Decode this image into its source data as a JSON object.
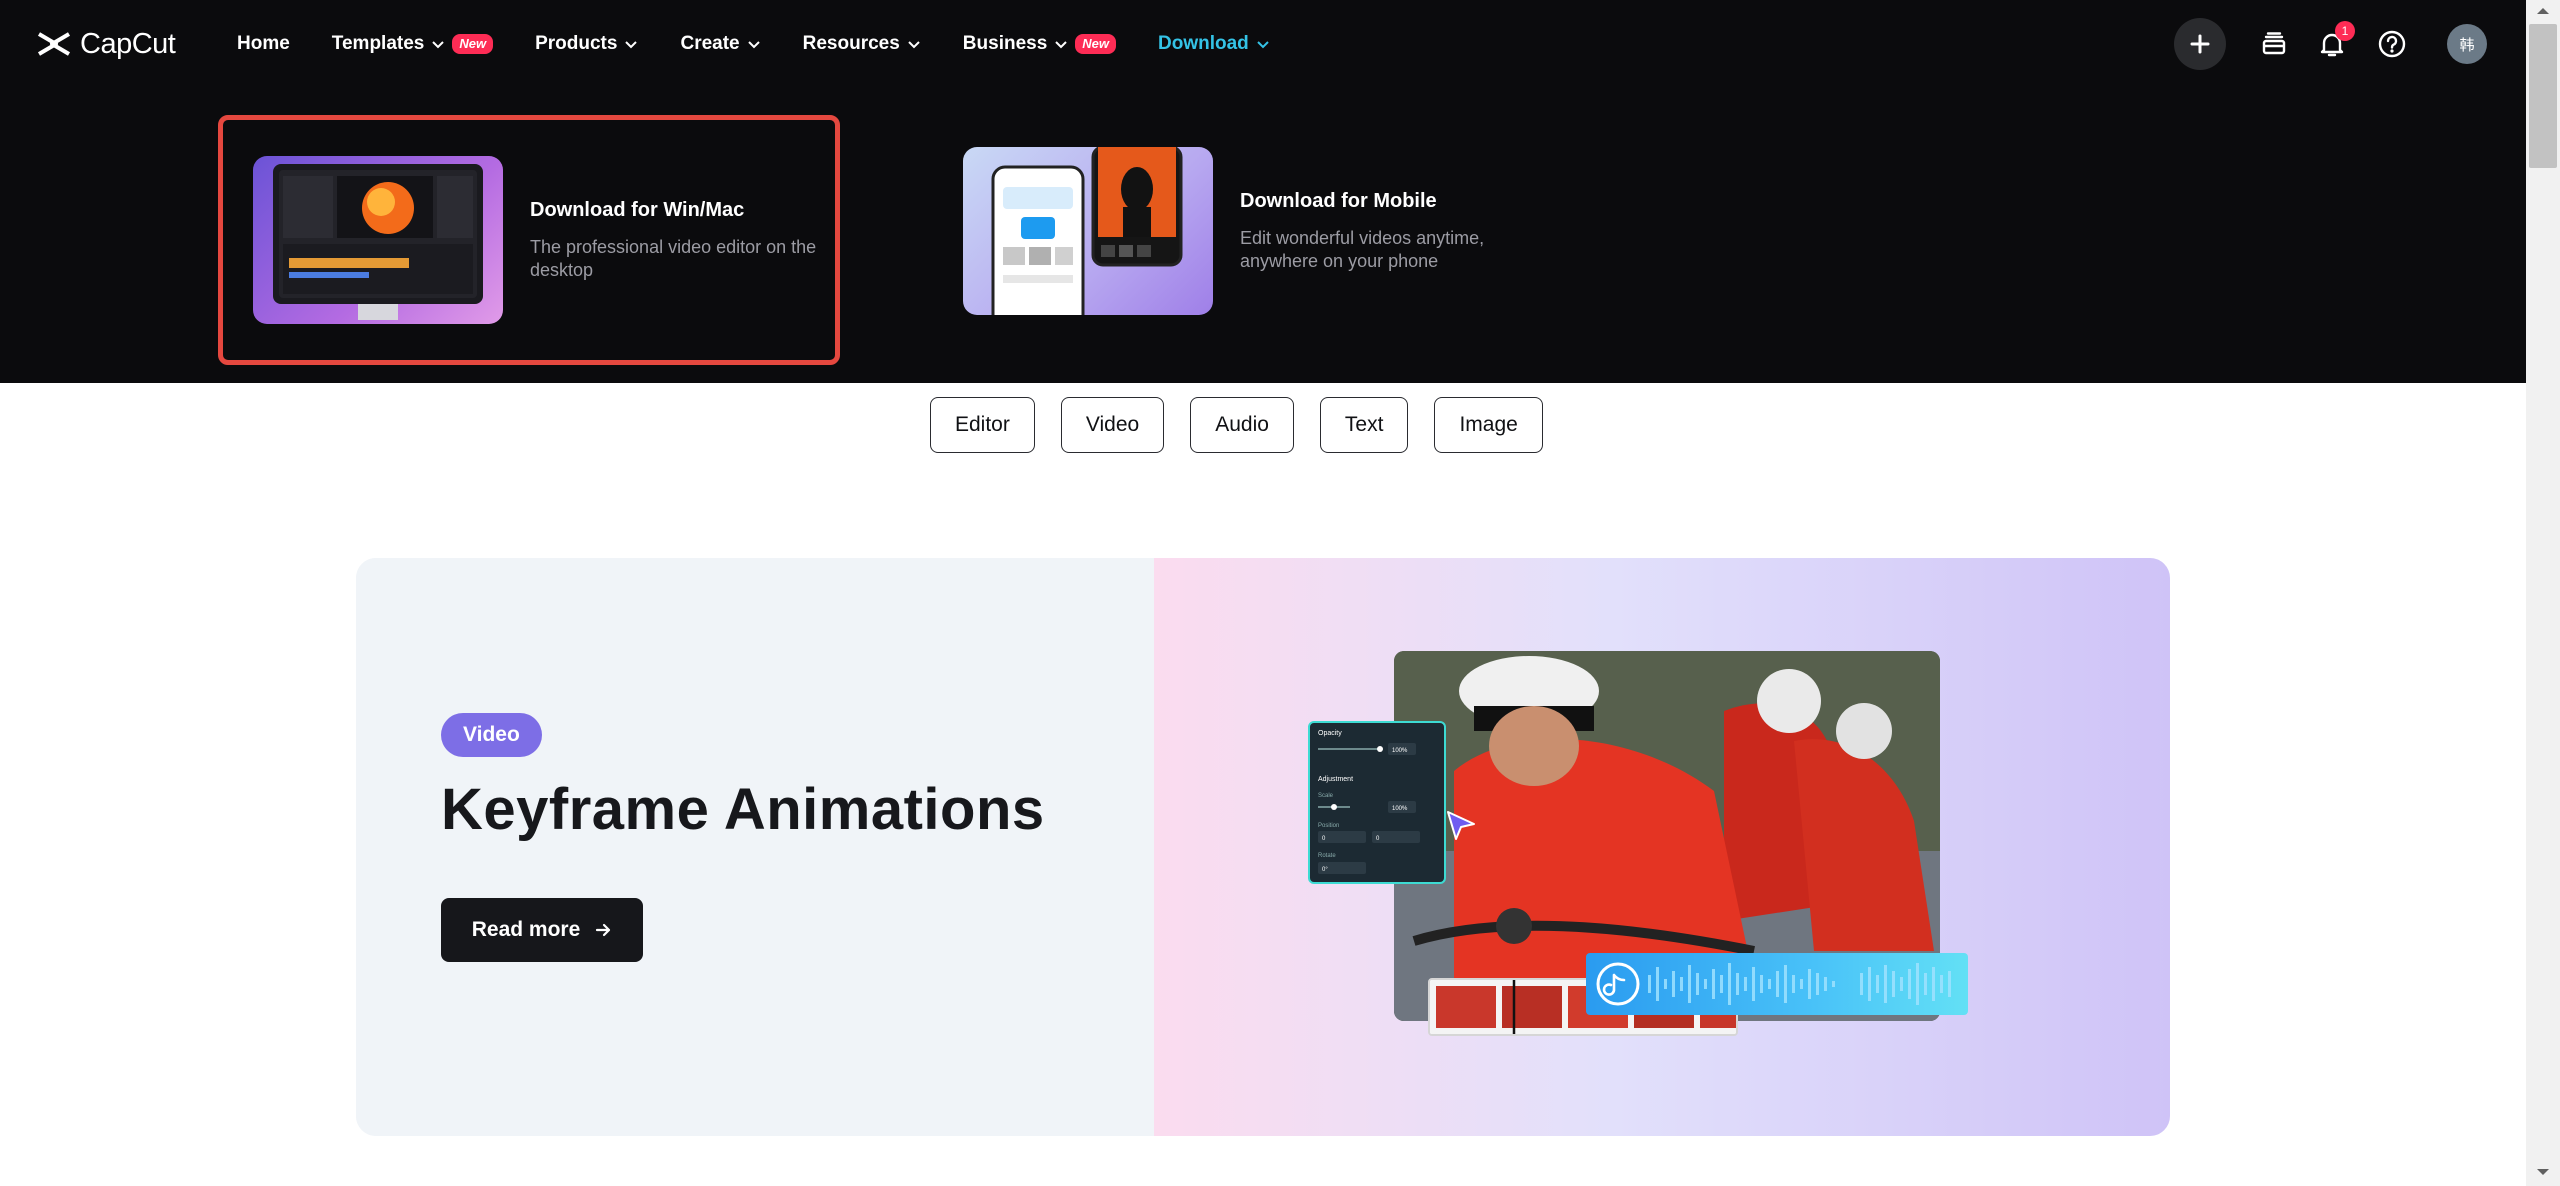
{
  "brand": {
    "name": "CapCut"
  },
  "nav": {
    "items": [
      {
        "label": "Home",
        "has_chevron": false,
        "badge": ""
      },
      {
        "label": "Templates",
        "has_chevron": true,
        "badge": "New"
      },
      {
        "label": "Products",
        "has_chevron": true,
        "badge": ""
      },
      {
        "label": "Create",
        "has_chevron": true,
        "badge": ""
      },
      {
        "label": "Resources",
        "has_chevron": true,
        "badge": ""
      },
      {
        "label": "Business",
        "has_chevron": true,
        "badge": "New"
      },
      {
        "label": "Download",
        "has_chevron": true,
        "badge": "",
        "active": true
      }
    ],
    "notification_count": "1",
    "avatar_text": "韩",
    "accent_color": "#34c3e6",
    "badge_color": "#fe2c55"
  },
  "download_menu": {
    "win": {
      "title": "Download for Win/Mac",
      "desc": "The professional video editor on the desktop"
    },
    "mobile": {
      "title": "Download for Mobile",
      "desc": "Edit wonderful videos anytime, anywhere on your phone"
    },
    "highlight_color": "#e5483f"
  },
  "category_tabs": [
    "Editor",
    "Video",
    "Audio",
    "Text",
    "Image"
  ],
  "feature": {
    "tag": "Video",
    "title": "Keyframe Animations",
    "cta": "Read more",
    "tag_color": "#7d6ee6"
  },
  "panel": {
    "opacity_label": "Opacity",
    "opacity_value": "100%",
    "adjustment_label": "Adjustment",
    "scale_label": "Scale",
    "scale_value": "100%",
    "position_label": "Position",
    "position_x": "0",
    "position_y": "0",
    "rotate_label": "Rotate",
    "rotate_value": "0°"
  }
}
